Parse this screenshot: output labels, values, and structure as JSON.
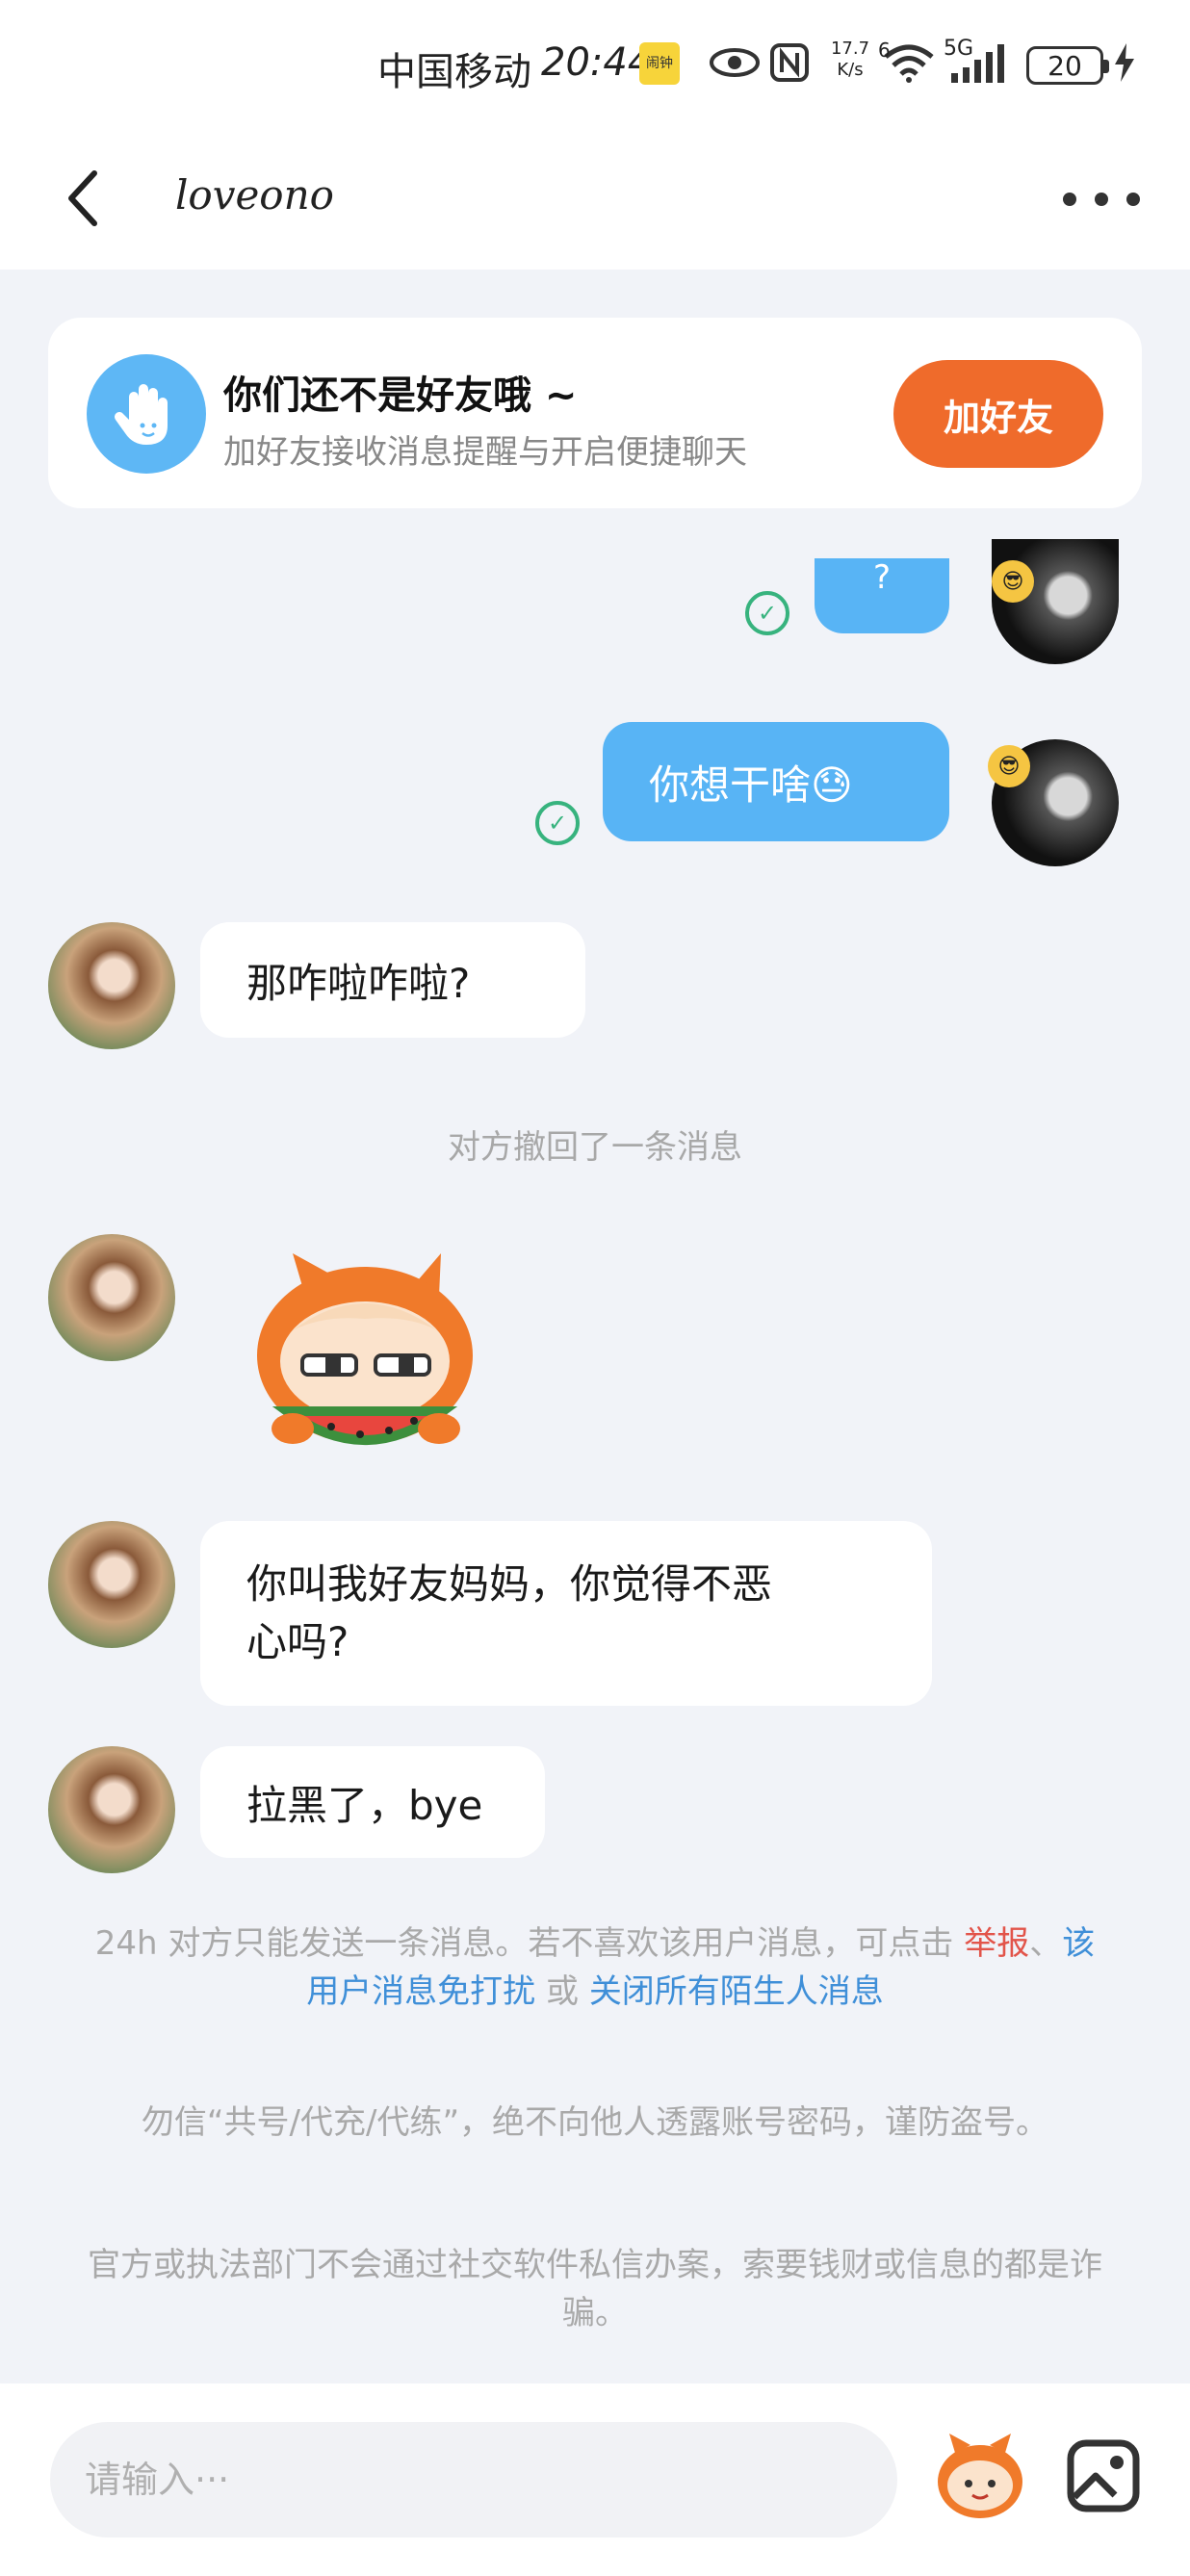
{
  "status_bar": {
    "carrier": "中国移动",
    "time": "20:44",
    "app_badge": "闹钟",
    "net_speed_value": "17.7",
    "net_speed_unit": "K/s",
    "signal_label": "5G",
    "wifi_label": "6",
    "battery": "20",
    "icons": [
      "eye-icon",
      "nfc-icon",
      "wifi-icon",
      "signal-icon",
      "battery-icon",
      "charging-icon"
    ]
  },
  "header": {
    "title": "loveono",
    "back_icon": "chevron-left-icon",
    "more_icon": "more-dots-icon"
  },
  "friend_banner": {
    "title": "你们还不是好友哦 ~",
    "subtitle": "加好友接收消息提醒与开启便捷聊天",
    "button": "加好友",
    "icon": "hand-wave-icon",
    "accent": "#ef6b2b"
  },
  "messages": [
    {
      "side": "out",
      "text": "?",
      "status": "read"
    },
    {
      "side": "out",
      "text": "你想干啥😓",
      "status": "read"
    },
    {
      "side": "in",
      "text": "那咋啦咋啦?"
    },
    {
      "side": "system",
      "text": "对方撤回了一条消息"
    },
    {
      "side": "in",
      "type": "sticker",
      "sticker": "orange-cat-eating-watermelon"
    },
    {
      "side": "in",
      "text_line1": "你叫我好友妈妈，你觉得不恶",
      "text_line2": "心吗?"
    },
    {
      "side": "in",
      "text": "拉黑了，bye"
    }
  ],
  "tips": {
    "notice_prefix": "24h 对方只能发送一条消息。若不喜欢该用户消息，可点击 ",
    "report_link": "举报",
    "sep": "、",
    "mute_link": "该用户消息免打扰",
    "or_text": " 或 ",
    "close_link": "关闭所有陌生人消息",
    "warning1": "勿信“共号/代充/代练”，绝不向他人透露账号密码，谨防盗号。",
    "warning2": "官方或执法部门不会通过社交软件私信办案，索要钱财或信息的都是诈骗。"
  },
  "input_bar": {
    "placeholder": "请输入···",
    "sticker_icon": "sticker-face-icon",
    "image_icon": "image-icon"
  },
  "colors": {
    "bubble_out": "#58b4f5",
    "bubble_in": "#ffffff",
    "background": "#f1f3f8",
    "read_check": "#37b37e",
    "report_red": "#e2544a",
    "link_blue": "#3f8fd8"
  }
}
